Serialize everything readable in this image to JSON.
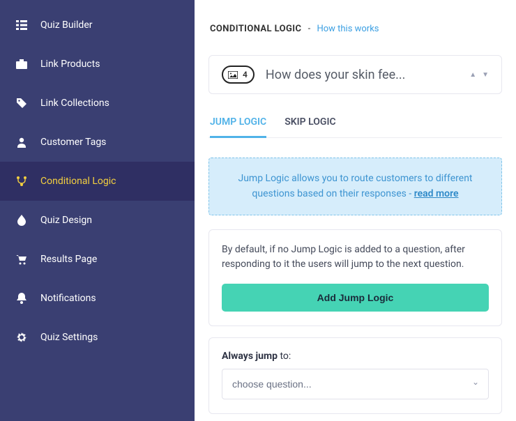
{
  "sidebar": {
    "items": [
      {
        "label": "Quiz Builder",
        "active": false
      },
      {
        "label": "Link Products",
        "active": false
      },
      {
        "label": "Link Collections",
        "active": false
      },
      {
        "label": "Customer Tags",
        "active": false
      },
      {
        "label": "Conditional Logic",
        "active": true
      },
      {
        "label": "Quiz Design",
        "active": false
      },
      {
        "label": "Results Page",
        "active": false
      },
      {
        "label": "Notifications",
        "active": false
      },
      {
        "label": "Quiz Settings",
        "active": false
      }
    ]
  },
  "header": {
    "title": "CONDITIONAL LOGIC",
    "sep": "-",
    "how_link": "How this works"
  },
  "question": {
    "number": "4",
    "text": "How does your skin fee..."
  },
  "tabs": {
    "jump": "JUMP LOGIC",
    "skip": "SKIP LOGIC"
  },
  "info": {
    "text": "Jump Logic allows you to route customers to different questions based on their responses - ",
    "link": "read more"
  },
  "default_card": {
    "text": "By default, if no Jump Logic is added to a question, after responding to it the users will jump to the next question.",
    "button": "Add Jump Logic"
  },
  "always": {
    "label_bold": "Always jump",
    "label_rest": " to:",
    "placeholder": "choose question..."
  }
}
